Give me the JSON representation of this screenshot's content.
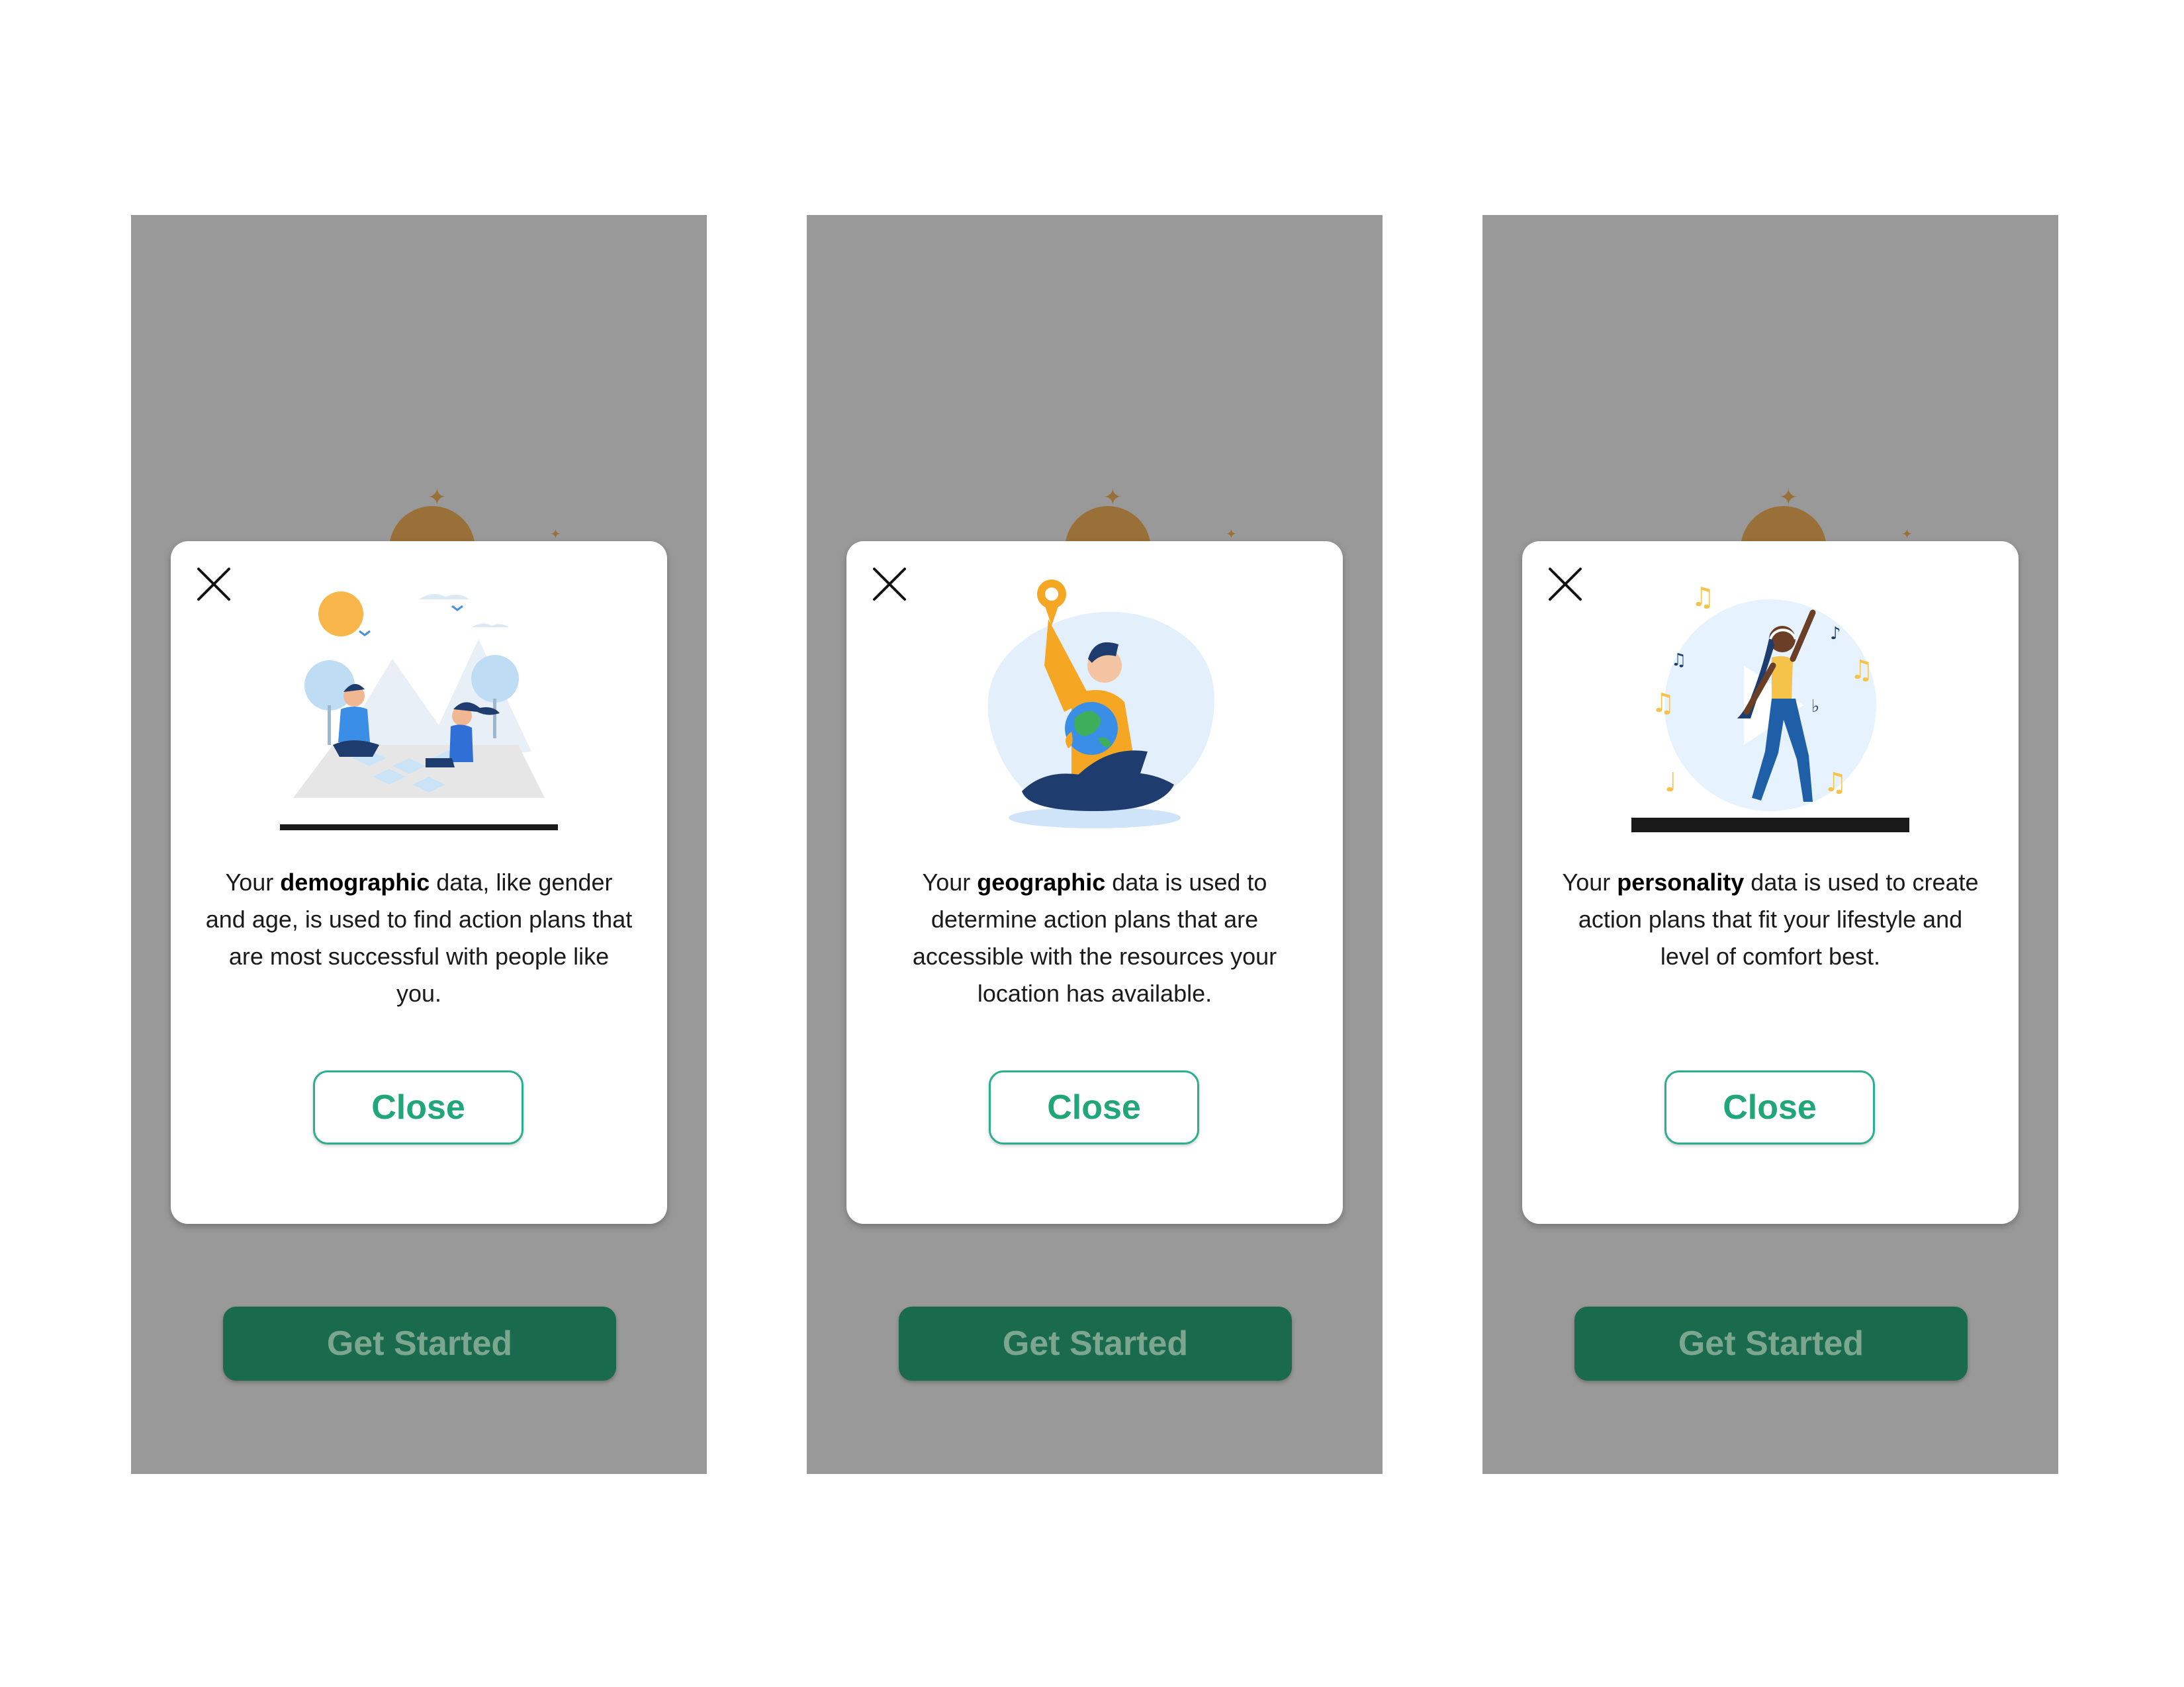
{
  "screens": [
    {
      "description": {
        "prefix": "Your ",
        "keyword": "demographic",
        "suffix": " data, like gender and age, is used to find action plans that are most successful with people like you."
      },
      "close_label": "Close",
      "get_started_label": "Get Started",
      "illustration": "picnic-illustration"
    },
    {
      "description": {
        "prefix": "Your ",
        "keyword": "geographic",
        "suffix": " data is used to determine action plans that are accessible with the resources your location has available."
      },
      "close_label": "Close",
      "get_started_label": "Get Started",
      "illustration": "globe-illustration"
    },
    {
      "description": {
        "prefix": "Your ",
        "keyword": "personality",
        "suffix": " data is used to create action plans that fit your lifestyle and level of comfort best."
      },
      "close_label": "Close",
      "get_started_label": "Get Started",
      "illustration": "music-illustration"
    }
  ],
  "colors": {
    "overlay": "#999999",
    "accent_green": "#21a679",
    "button_dark_green": "#1a6b4d",
    "sun_brown": "#9a7039"
  },
  "icons": [
    "close-icon",
    "sun-icon",
    "sparkle-icon"
  ]
}
